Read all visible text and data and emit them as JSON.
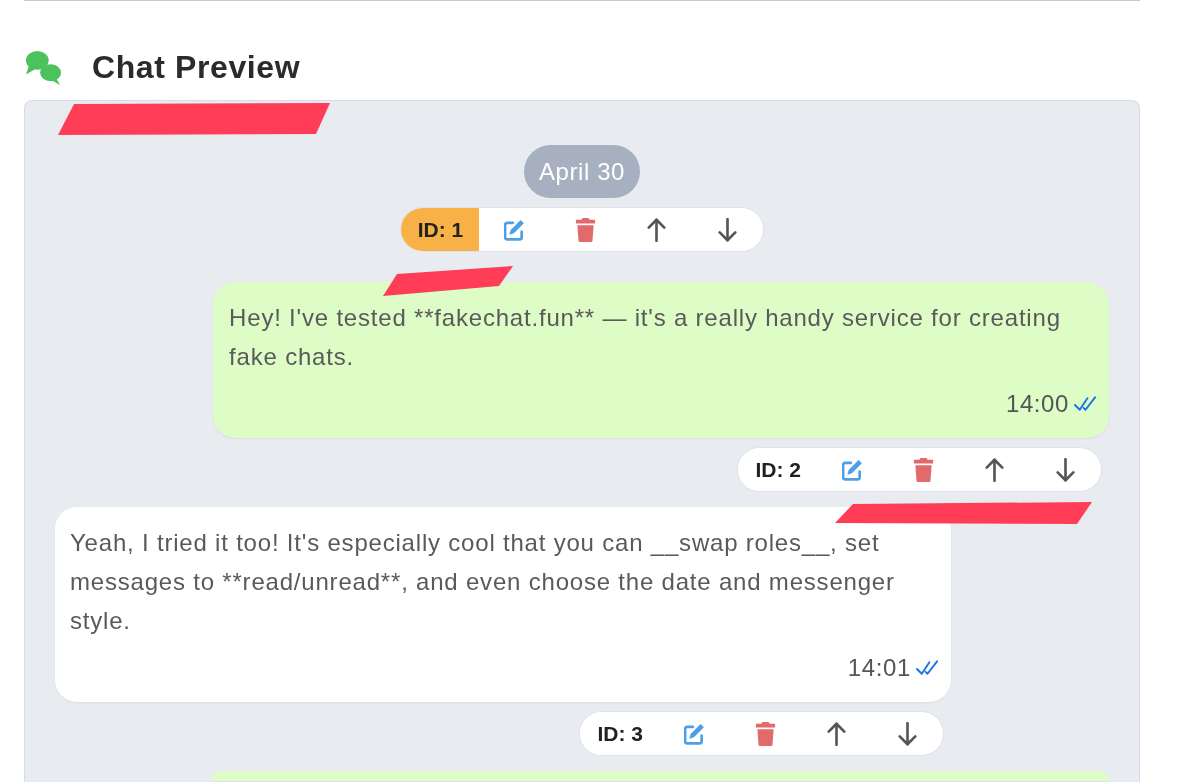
{
  "section": {
    "title": "Chat Preview"
  },
  "chat": {
    "items": [
      {
        "kind": "date",
        "text": "April 30",
        "toolbar": {
          "id_label": "ID: 1",
          "selected": true
        }
      },
      {
        "kind": "outgoing",
        "text": "Hey! I've tested **fakechat.fun** — it's a really handy service for creating fake chats.",
        "time": "14:00",
        "read": true,
        "toolbar": {
          "id_label": "ID: 2",
          "selected": false
        }
      },
      {
        "kind": "incoming",
        "text": "Yeah, I tried it too! It's especially cool that you can __swap roles__, set messages to **read/unread**, and even choose the date and messenger style.",
        "time": "14:01",
        "read": true,
        "toolbar": {
          "id_label": "ID: 3",
          "selected": false
        }
      },
      {
        "kind": "outgoing"
      }
    ]
  }
}
